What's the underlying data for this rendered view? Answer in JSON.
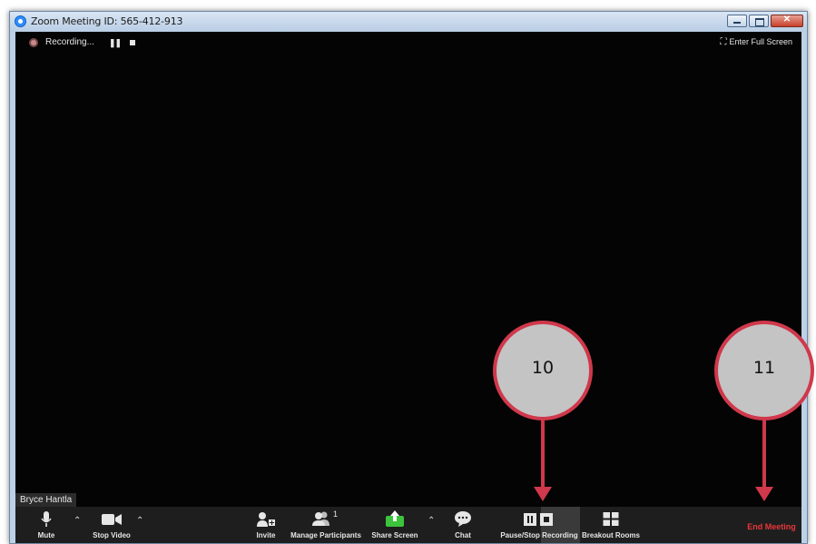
{
  "window": {
    "title": "Zoom Meeting ID: 565-412-913"
  },
  "recording": {
    "status": "Recording..."
  },
  "fullscreen": {
    "label": "Enter Full Screen"
  },
  "participant": {
    "name": "Bryce Hantla"
  },
  "toolbar": {
    "mute": "Mute",
    "stop_video": "Stop Video",
    "invite": "Invite",
    "manage_participants": "Manage Participants",
    "participant_count": "1",
    "share_screen": "Share Screen",
    "chat": "Chat",
    "pause_stop_recording": "Pause/Stop Recording",
    "breakout_rooms": "Breakout Rooms",
    "end_meeting": "End Meeting"
  },
  "callouts": [
    {
      "number": "10"
    },
    {
      "number": "11"
    }
  ],
  "colors": {
    "callout_border": "#d0384b",
    "end_meeting": "#e8363a",
    "share_green": "#3cc43c",
    "toolbar_bg": "#1e1e1e"
  }
}
